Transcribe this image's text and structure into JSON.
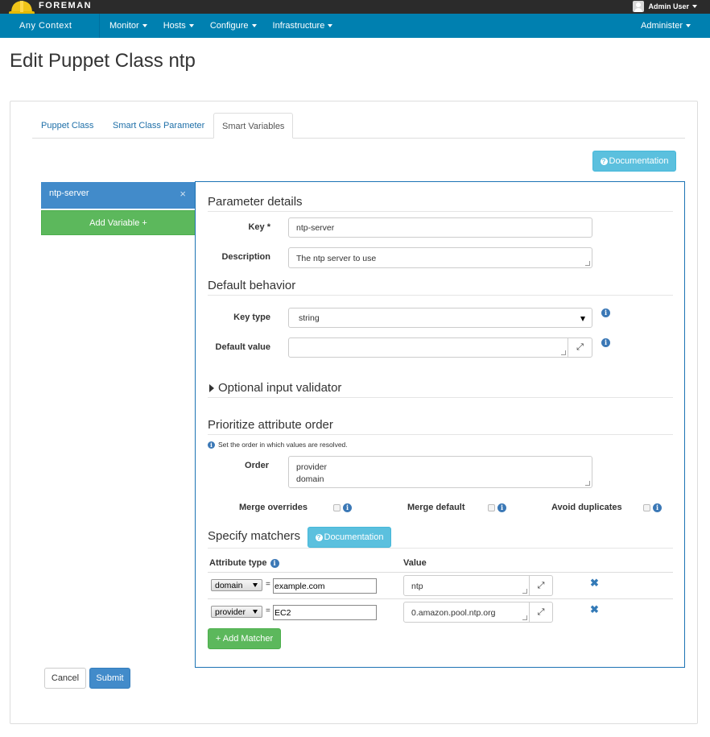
{
  "header": {
    "brand": "FOREMAN",
    "user": "Admin User"
  },
  "nav": {
    "context": "Any Context",
    "items": [
      "Monitor",
      "Hosts",
      "Configure",
      "Infrastructure"
    ],
    "admin": "Administer"
  },
  "page": {
    "title": "Edit Puppet Class ntp"
  },
  "tabs": [
    "Puppet Class",
    "Smart Class Parameter",
    "Smart Variables"
  ],
  "documentation_label": "Documentation",
  "variables": {
    "selected": "ntp-server",
    "add_label": "Add Variable +"
  },
  "parameter_details": {
    "title": "Parameter details",
    "key_label": "Key *",
    "key_value": "ntp-server",
    "description_label": "Description",
    "description_value": "The ntp server to use"
  },
  "default_behavior": {
    "title": "Default behavior",
    "key_type_label": "Key type",
    "key_type_value": "string",
    "default_value_label": "Default value",
    "default_value": ""
  },
  "validator": {
    "title": "Optional input validator"
  },
  "priority": {
    "title": "Prioritize attribute order",
    "hint": "Set the order in which values are resolved.",
    "order_label": "Order",
    "order_lines": [
      "provider",
      "domain"
    ],
    "merge_overrides_label": "Merge overrides",
    "merge_default_label": "Merge default",
    "avoid_duplicates_label": "Avoid duplicates"
  },
  "matchers": {
    "title": "Specify matchers",
    "doc_label": "Documentation",
    "attribute_type_header": "Attribute type",
    "value_header": "Value",
    "rows": [
      {
        "attribute": "domain",
        "match": "example.com",
        "value": "ntp"
      },
      {
        "attribute": "provider",
        "match": "EC2",
        "value": "0.amazon.pool.ntp.org"
      }
    ],
    "add_label": "+ Add Matcher",
    "eq": "="
  },
  "actions": {
    "cancel": "Cancel",
    "submit": "Submit"
  },
  "colors": {
    "nav": "#0080b0",
    "topbar": "#2b2b2b",
    "panel_border": "#1c73b4",
    "primary": "#428bca",
    "success": "#5cb85c",
    "info": "#5bc0de"
  },
  "icons": [
    "foreman-helmet-icon",
    "user-avatar-icon",
    "question-circle-icon",
    "info-icon",
    "expand-icon",
    "remove-icon",
    "close-icon",
    "caret-right-icon"
  ]
}
